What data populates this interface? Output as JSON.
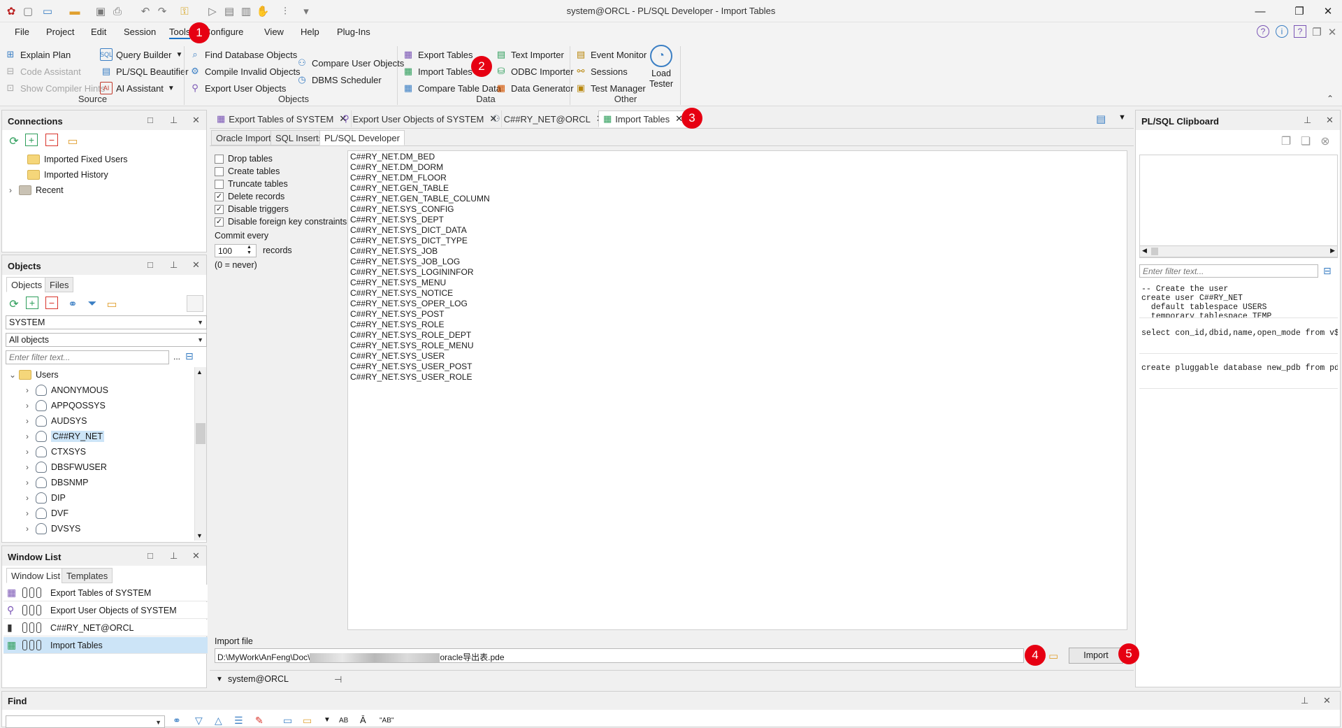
{
  "window": {
    "title": "system@ORCL - PL/SQL Developer - Import Tables"
  },
  "menu": [
    "File",
    "Project",
    "Edit",
    "Session",
    "Tools",
    "Configure",
    "View",
    "Help",
    "Plug-Ins"
  ],
  "ribbon": {
    "source": {
      "label": "Source",
      "items": [
        "Explain Plan",
        "Code Assistant",
        "Show Compiler Hints",
        "Query Builder",
        "PL/SQL Beautifier",
        "AI Assistant"
      ]
    },
    "objects": {
      "label": "Objects",
      "items": [
        "Find Database Objects",
        "Compile Invalid Objects",
        "Export User Objects",
        "Compare User Objects",
        "DBMS Scheduler"
      ]
    },
    "data": {
      "label": "Data",
      "items": [
        "Export Tables",
        "Import Tables",
        "Compare Table Data",
        "Text Importer",
        "ODBC Importer",
        "Data Generator"
      ]
    },
    "other": {
      "label": "Other",
      "items": [
        "Event Monitor",
        "Sessions",
        "Test Manager",
        "Load Tester"
      ]
    }
  },
  "connections": {
    "title": "Connections",
    "items": [
      "Imported Fixed Users",
      "Imported History",
      "Recent"
    ]
  },
  "objects_panel": {
    "title": "Objects",
    "tabs": [
      "Objects",
      "Files"
    ],
    "owner": "SYSTEM",
    "filter": "All objects",
    "filter_placeholder": "Enter filter text...",
    "filter_more": "...",
    "root": "Users",
    "users": [
      "ANONYMOUS",
      "APPQOSSYS",
      "AUDSYS",
      "C##RY_NET",
      "CTXSYS",
      "DBSFWUSER",
      "DBSNMP",
      "DIP",
      "DVF",
      "DVSYS"
    ],
    "selected_user": "C##RY_NET"
  },
  "window_list": {
    "title": "Window List",
    "tabs": [
      "Window List",
      "Templates"
    ],
    "items": [
      "Export Tables of SYSTEM",
      "Export User Objects of SYSTEM",
      "C##RY_NET@ORCL",
      "Import Tables"
    ],
    "selected": "Import Tables"
  },
  "doc_tabs": [
    "Export Tables of SYSTEM",
    "Export User Objects of SYSTEM",
    "C##RY_NET@ORCL",
    "Import Tables"
  ],
  "active_doc_tab": "Import Tables",
  "import_tabs": [
    "Oracle Import",
    "SQL Inserts",
    "PL/SQL Developer"
  ],
  "active_import_tab": "PL/SQL Developer",
  "options": [
    {
      "label": "Drop tables",
      "checked": false
    },
    {
      "label": "Create tables",
      "checked": false
    },
    {
      "label": "Truncate tables",
      "checked": false
    },
    {
      "label": "Delete records",
      "checked": true
    },
    {
      "label": "Disable triggers",
      "checked": true
    },
    {
      "label": "Disable foreign key constraints",
      "checked": true
    }
  ],
  "commit": {
    "label": "Commit every",
    "value": "100",
    "unit": "records",
    "note": "(0 = never)"
  },
  "tables": [
    "C##RY_NET.DM_BED",
    "C##RY_NET.DM_DORM",
    "C##RY_NET.DM_FLOOR",
    "C##RY_NET.GEN_TABLE",
    "C##RY_NET.GEN_TABLE_COLUMN",
    "C##RY_NET.SYS_CONFIG",
    "C##RY_NET.SYS_DEPT",
    "C##RY_NET.SYS_DICT_DATA",
    "C##RY_NET.SYS_DICT_TYPE",
    "C##RY_NET.SYS_JOB",
    "C##RY_NET.SYS_JOB_LOG",
    "C##RY_NET.SYS_LOGININFOR",
    "C##RY_NET.SYS_MENU",
    "C##RY_NET.SYS_NOTICE",
    "C##RY_NET.SYS_OPER_LOG",
    "C##RY_NET.SYS_POST",
    "C##RY_NET.SYS_ROLE",
    "C##RY_NET.SYS_ROLE_DEPT",
    "C##RY_NET.SYS_ROLE_MENU",
    "C##RY_NET.SYS_USER",
    "C##RY_NET.SYS_USER_POST",
    "C##RY_NET.SYS_USER_ROLE"
  ],
  "import_file": {
    "label": "Import file",
    "path_start": "D:\\MyWork\\AnFeng\\Doc\\",
    "path_end": "oracle导出表.pde",
    "button": "Import"
  },
  "session": "system@ORCL",
  "clipboard": {
    "title": "PL/SQL Clipboard",
    "filter_placeholder": "Enter filter text...",
    "snippets": [
      "-- Create the user\ncreate user C##RY_NET\n  default tablespace USERS\n  temporary tablespace TEMP",
      "select con_id,dbid,name,open_mode from v$",
      "create pluggable database new_pdb from pdb"
    ]
  },
  "find": {
    "title": "Find",
    "tools": [
      "AB",
      "\"AB\""
    ]
  },
  "annotations": [
    "1",
    "2",
    "3",
    "4",
    "5"
  ],
  "colors": {
    "accent": "#1a73c8",
    "selection": "#cce4f7",
    "badge": "#e60012"
  }
}
